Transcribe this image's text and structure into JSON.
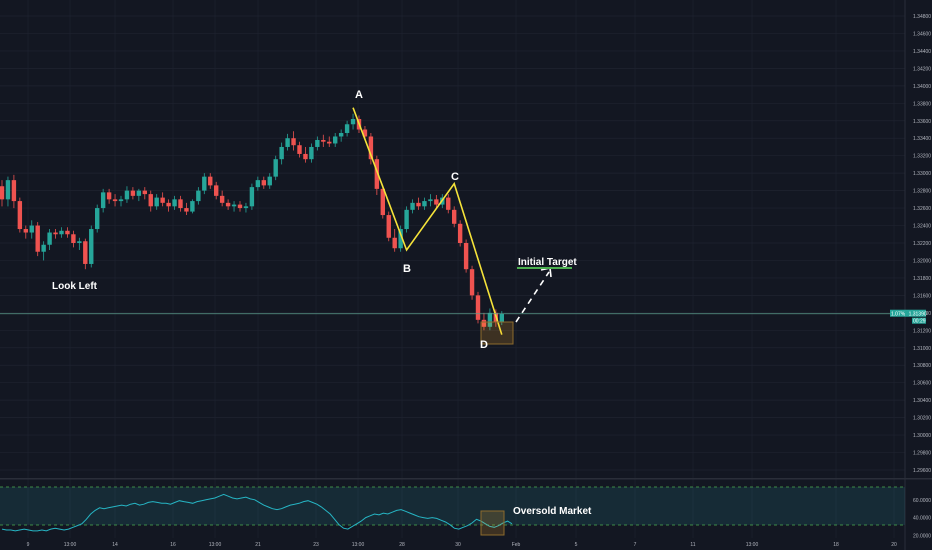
{
  "chart_data": {
    "type": "candlestick",
    "price_ylim": [
      1.2925,
      1.3483
    ],
    "rsi_ylim": [
      17,
      80
    ],
    "y_ticks": [
      "1.34800",
      "1.34600",
      "1.34400",
      "1.34200",
      "1.34000",
      "1.33800",
      "1.33600",
      "1.33400",
      "1.33200",
      "1.33000",
      "1.32800",
      "1.32600",
      "1.32400",
      "1.32200",
      "1.32000",
      "1.31800",
      "1.31600",
      "1.31400",
      "1.31200",
      "1.31000",
      "1.30800",
      "1.30600",
      "1.30400",
      "1.30200",
      "1.30000",
      "1.29800",
      "1.29600"
    ],
    "rsi_ticks": [
      "60.0000",
      "40.0000",
      "20.0000"
    ],
    "x_ticks": [
      "9",
      "13:00",
      "14",
      "16",
      "13:00",
      "21",
      "23",
      "13:00",
      "28",
      "30",
      "Feb",
      "5",
      "7",
      "11",
      "13:00",
      "18",
      "20"
    ],
    "last_price": "1.31390",
    "last_price_value": 1.3139,
    "price_tag_left": "1.07%",
    "price_tag_small": "00:29",
    "annotations": {
      "look_left": "Look Left",
      "initial_target": "Initial Target",
      "oversold": "Oversold Market",
      "A": "A",
      "B": "B",
      "C": "C",
      "D": "D"
    },
    "pattern": {
      "A": {
        "bar": 59,
        "price": 1.3375
      },
      "B": {
        "bar": 68,
        "price": 1.3212
      },
      "C": {
        "bar": 76,
        "price": 1.3288
      },
      "D": {
        "bar": 84,
        "price": 1.3115
      },
      "target_price": 1.3188
    },
    "candles": [
      [
        1.3285,
        1.3292,
        1.3262,
        1.327
      ],
      [
        1.327,
        1.3296,
        1.3262,
        1.3292
      ],
      [
        1.3292,
        1.3298,
        1.326,
        1.3268
      ],
      [
        1.3268,
        1.3272,
        1.3232,
        1.3236
      ],
      [
        1.3236,
        1.324,
        1.3225,
        1.3232
      ],
      [
        1.3232,
        1.3246,
        1.3225,
        1.324
      ],
      [
        1.324,
        1.3244,
        1.3205,
        1.321
      ],
      [
        1.321,
        1.3222,
        1.32,
        1.3218
      ],
      [
        1.3218,
        1.3236,
        1.3212,
        1.3232
      ],
      [
        1.3232,
        1.3236,
        1.3225,
        1.323
      ],
      [
        1.323,
        1.3238,
        1.3226,
        1.3234
      ],
      [
        1.3234,
        1.3238,
        1.3226,
        1.323
      ],
      [
        1.323,
        1.3234,
        1.3215,
        1.322
      ],
      [
        1.322,
        1.3226,
        1.3212,
        1.3222
      ],
      [
        1.3222,
        1.3225,
        1.319,
        1.3196
      ],
      [
        1.3196,
        1.324,
        1.3192,
        1.3236
      ],
      [
        1.3236,
        1.3264,
        1.3232,
        1.326
      ],
      [
        1.326,
        1.3282,
        1.3255,
        1.3278
      ],
      [
        1.3278,
        1.3282,
        1.3265,
        1.327
      ],
      [
        1.327,
        1.3276,
        1.3262,
        1.3268
      ],
      [
        1.3268,
        1.3274,
        1.3262,
        1.327
      ],
      [
        1.327,
        1.3285,
        1.3266,
        1.328
      ],
      [
        1.328,
        1.3284,
        1.327,
        1.3274
      ],
      [
        1.3274,
        1.3282,
        1.3268,
        1.328
      ],
      [
        1.328,
        1.3284,
        1.327,
        1.3276
      ],
      [
        1.3276,
        1.328,
        1.3256,
        1.3262
      ],
      [
        1.3262,
        1.3276,
        1.3258,
        1.3272
      ],
      [
        1.3272,
        1.3278,
        1.3262,
        1.3266
      ],
      [
        1.3266,
        1.327,
        1.3256,
        1.3262
      ],
      [
        1.3262,
        1.3274,
        1.3258,
        1.327
      ],
      [
        1.327,
        1.3274,
        1.3256,
        1.326
      ],
      [
        1.326,
        1.3266,
        1.3252,
        1.3256
      ],
      [
        1.3256,
        1.327,
        1.3254,
        1.3268
      ],
      [
        1.3268,
        1.3284,
        1.3264,
        1.328
      ],
      [
        1.328,
        1.33,
        1.3276,
        1.3296
      ],
      [
        1.3296,
        1.33,
        1.3282,
        1.3286
      ],
      [
        1.3286,
        1.329,
        1.327,
        1.3274
      ],
      [
        1.3274,
        1.328,
        1.3262,
        1.3266
      ],
      [
        1.3266,
        1.327,
        1.3258,
        1.3262
      ],
      [
        1.3262,
        1.3268,
        1.3256,
        1.3264
      ],
      [
        1.3264,
        1.3268,
        1.3256,
        1.326
      ],
      [
        1.326,
        1.3266,
        1.3255,
        1.3262
      ],
      [
        1.3262,
        1.3288,
        1.3258,
        1.3284
      ],
      [
        1.3284,
        1.3296,
        1.328,
        1.3292
      ],
      [
        1.3292,
        1.3296,
        1.3282,
        1.3286
      ],
      [
        1.3286,
        1.33,
        1.3282,
        1.3296
      ],
      [
        1.3296,
        1.332,
        1.3292,
        1.3316
      ],
      [
        1.3316,
        1.3335,
        1.331,
        1.333
      ],
      [
        1.333,
        1.3345,
        1.3326,
        1.334
      ],
      [
        1.334,
        1.3348,
        1.3326,
        1.3332
      ],
      [
        1.3332,
        1.3336,
        1.3318,
        1.3322
      ],
      [
        1.3322,
        1.333,
        1.3312,
        1.3316
      ],
      [
        1.3316,
        1.3334,
        1.3312,
        1.333
      ],
      [
        1.333,
        1.3342,
        1.3326,
        1.3338
      ],
      [
        1.3338,
        1.3344,
        1.333,
        1.3336
      ],
      [
        1.3336,
        1.3342,
        1.333,
        1.3334
      ],
      [
        1.3334,
        1.3346,
        1.333,
        1.3342
      ],
      [
        1.3342,
        1.335,
        1.3336,
        1.3346
      ],
      [
        1.3346,
        1.336,
        1.3342,
        1.3356
      ],
      [
        1.3356,
        1.3368,
        1.335,
        1.3362
      ],
      [
        1.3362,
        1.3366,
        1.3346,
        1.335
      ],
      [
        1.335,
        1.3354,
        1.3338,
        1.3342
      ],
      [
        1.3342,
        1.3346,
        1.331,
        1.3316
      ],
      [
        1.3316,
        1.332,
        1.3275,
        1.3282
      ],
      [
        1.3282,
        1.3286,
        1.3248,
        1.3252
      ],
      [
        1.3252,
        1.3256,
        1.3222,
        1.3226
      ],
      [
        1.3226,
        1.3236,
        1.321,
        1.3214
      ],
      [
        1.3214,
        1.324,
        1.321,
        1.3236
      ],
      [
        1.3236,
        1.3262,
        1.3232,
        1.3258
      ],
      [
        1.3258,
        1.327,
        1.3254,
        1.3266
      ],
      [
        1.3266,
        1.3272,
        1.3258,
        1.3262
      ],
      [
        1.3262,
        1.3272,
        1.3258,
        1.3268
      ],
      [
        1.3268,
        1.3276,
        1.3262,
        1.327
      ],
      [
        1.327,
        1.3275,
        1.326,
        1.3264
      ],
      [
        1.3264,
        1.3276,
        1.326,
        1.3272
      ],
      [
        1.3272,
        1.3276,
        1.3254,
        1.3258
      ],
      [
        1.3258,
        1.3262,
        1.3238,
        1.3242
      ],
      [
        1.3242,
        1.3246,
        1.3216,
        1.322
      ],
      [
        1.322,
        1.3224,
        1.3186,
        1.319
      ],
      [
        1.319,
        1.3194,
        1.3155,
        1.316
      ],
      [
        1.316,
        1.3164,
        1.3128,
        1.3132
      ],
      [
        1.3132,
        1.314,
        1.312,
        1.3124
      ],
      [
        1.3124,
        1.3145,
        1.312,
        1.314
      ],
      [
        1.314,
        1.3144,
        1.3124,
        1.313
      ],
      [
        1.313,
        1.3142,
        1.3126,
        1.3139
      ]
    ],
    "rsi": [
      27,
      26,
      26,
      25,
      26,
      27,
      26,
      25,
      25,
      26,
      25,
      27,
      28,
      27,
      26,
      27,
      29,
      31,
      33,
      38,
      44,
      48,
      51,
      50,
      51,
      52,
      53,
      54,
      53,
      55,
      56,
      54,
      55,
      57,
      58,
      57,
      56,
      56,
      55,
      57,
      59,
      58,
      57,
      56,
      58,
      59,
      60,
      61,
      62,
      64,
      66,
      64,
      62,
      61,
      62,
      63,
      61,
      60,
      57,
      54,
      52,
      50,
      49,
      50,
      52,
      54,
      55,
      56,
      58,
      59,
      57,
      55,
      52,
      48,
      44,
      38,
      32,
      28,
      27,
      30,
      33,
      36,
      40,
      42,
      44,
      43,
      45,
      44,
      46,
      48,
      49,
      47,
      45,
      43,
      41,
      40,
      39,
      40,
      39,
      37,
      35,
      32,
      28,
      27,
      29,
      31,
      34,
      38,
      36,
      33,
      30,
      29,
      31,
      34,
      36,
      33
    ]
  }
}
